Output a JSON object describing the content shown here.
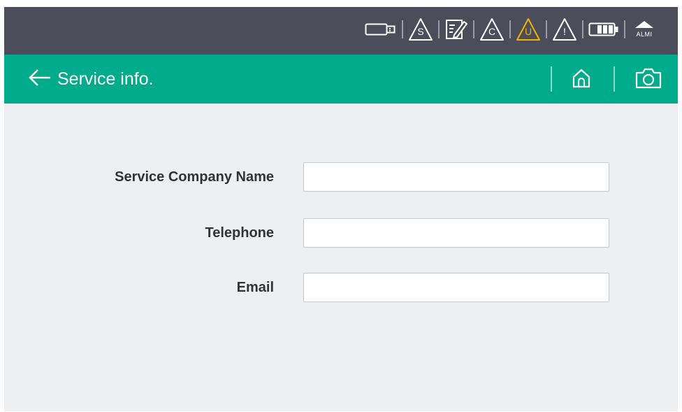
{
  "status_bar": {
    "icons": [
      {
        "name": "usb-drive-icon"
      },
      {
        "name": "service-warning-icon",
        "letter": "S",
        "color": "#ffffff"
      },
      {
        "name": "edit-note-icon"
      },
      {
        "name": "c-warning-icon",
        "letter": "C",
        "color": "#ffffff"
      },
      {
        "name": "u-warning-icon",
        "letter": "U",
        "color": "#f0b400"
      },
      {
        "name": "general-warning-icon",
        "letter": "!",
        "color": "#ffffff"
      },
      {
        "name": "battery-icon"
      },
      {
        "name": "alarm-icon",
        "label": "ALMI"
      }
    ]
  },
  "title_bar": {
    "title": "Service info.",
    "back_icon": "arrow-left-icon",
    "home_icon": "home-icon",
    "camera_icon": "camera-icon",
    "color": "#00ab8c"
  },
  "form": {
    "company": {
      "label": "Service Company Name",
      "value": "",
      "placeholder": ""
    },
    "telephone": {
      "label": "Telephone",
      "value": "",
      "placeholder": ""
    },
    "email": {
      "label": "Email",
      "value": "",
      "placeholder": ""
    }
  }
}
